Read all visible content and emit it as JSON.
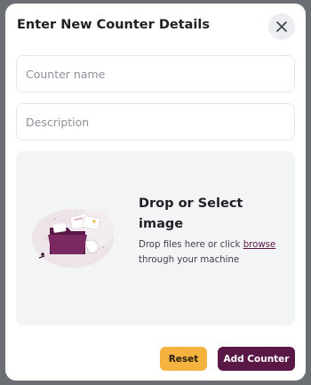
{
  "modal": {
    "title": "Enter New Counter Details",
    "close_icon": "close-icon"
  },
  "form": {
    "counter_name": {
      "value": "",
      "placeholder": "Counter name"
    },
    "description": {
      "value": "",
      "placeholder": "Description"
    }
  },
  "dropzone": {
    "title": "Drop or Select image",
    "text_before": "Drop files here or click",
    "browse_link": "browse",
    "text_after": "through your machine",
    "illustration_icon": "folder-upload-illustration"
  },
  "actions": {
    "reset_label": "Reset",
    "add_label": "Add Counter"
  },
  "colors": {
    "primary": "#5a1846",
    "accent": "#f4b33f",
    "overlay": "#6b6e72"
  }
}
